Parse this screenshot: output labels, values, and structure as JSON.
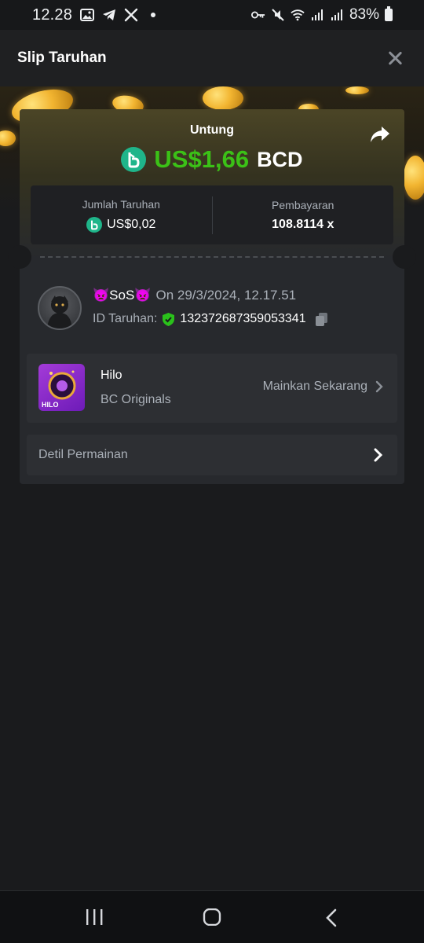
{
  "status_bar": {
    "time": "12.28",
    "battery": "83%",
    "icons": [
      "gallery-icon",
      "telegram-icon",
      "x-icon",
      "dot-icon",
      "key-icon",
      "mute-icon",
      "wifi-icon",
      "signal-icon",
      "signal-icon",
      "battery-icon"
    ]
  },
  "header": {
    "title": "Slip Taruhan",
    "close_icon": "close-icon"
  },
  "profit": {
    "label": "Untung",
    "amount": "US$1,66",
    "currency": "BCD",
    "coin_icon": "bcd-coin-icon",
    "share_icon": "share-icon",
    "amount_color": "#3bc117"
  },
  "stats": {
    "bet_amount_label": "Jumlah Taruhan",
    "bet_amount_value": "US$0,02",
    "payout_label": "Pembayaran",
    "payout_value": "108.8114 x"
  },
  "player": {
    "name": "👿SoS👿",
    "date_text": "On 29/3/2024, 12.17.51",
    "bet_id_label": "ID Taruhan:",
    "bet_id": "132372687359053341",
    "verified_icon": "shield-check-icon",
    "copy_icon": "copy-icon"
  },
  "game": {
    "name": "Hilo",
    "provider": "BC Originals",
    "play_now": "Mainkan Sekarang",
    "thumb_label": "HILO"
  },
  "details": {
    "label": "Detil Permainan"
  },
  "nav": {
    "recents_icon": "recents-icon",
    "home_icon": "home-icon",
    "back_icon": "back-icon"
  },
  "colors": {
    "background": "#1a1b1d",
    "card": "#27292d",
    "accent_green": "#3bc117",
    "coin_teal": "#1fb58a"
  }
}
